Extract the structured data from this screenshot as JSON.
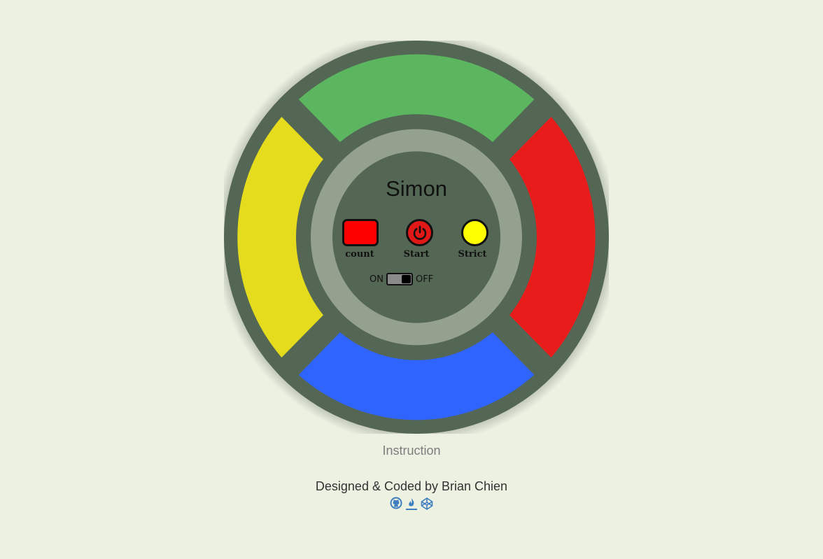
{
  "game": {
    "title": "Simon",
    "count_display": "",
    "count_label": "count",
    "start_label": "Start",
    "strict_label": "Strict",
    "switch_on_label": "ON",
    "switch_off_label": "OFF",
    "switch_state": "OFF"
  },
  "pads": {
    "top": {
      "color": "#5cb660"
    },
    "right": {
      "color": "#e91c1c"
    },
    "bottom": {
      "color": "#2f64ff"
    },
    "left": {
      "color": "#e4dc1c"
    }
  },
  "colors": {
    "background": "#ecf1e2",
    "board": "#546654",
    "inner_ring": "#95a18f",
    "count_box": "#ff0000",
    "start_button": "#e01818",
    "strict_button": "#ffff00",
    "social_icon": "#3f7fbf"
  },
  "footer": {
    "instruction_link": "Instruction",
    "credit": "Designed & Coded by Brian Chien",
    "social_icons": [
      "github-icon",
      "freecodecamp-icon",
      "codepen-icon"
    ]
  }
}
